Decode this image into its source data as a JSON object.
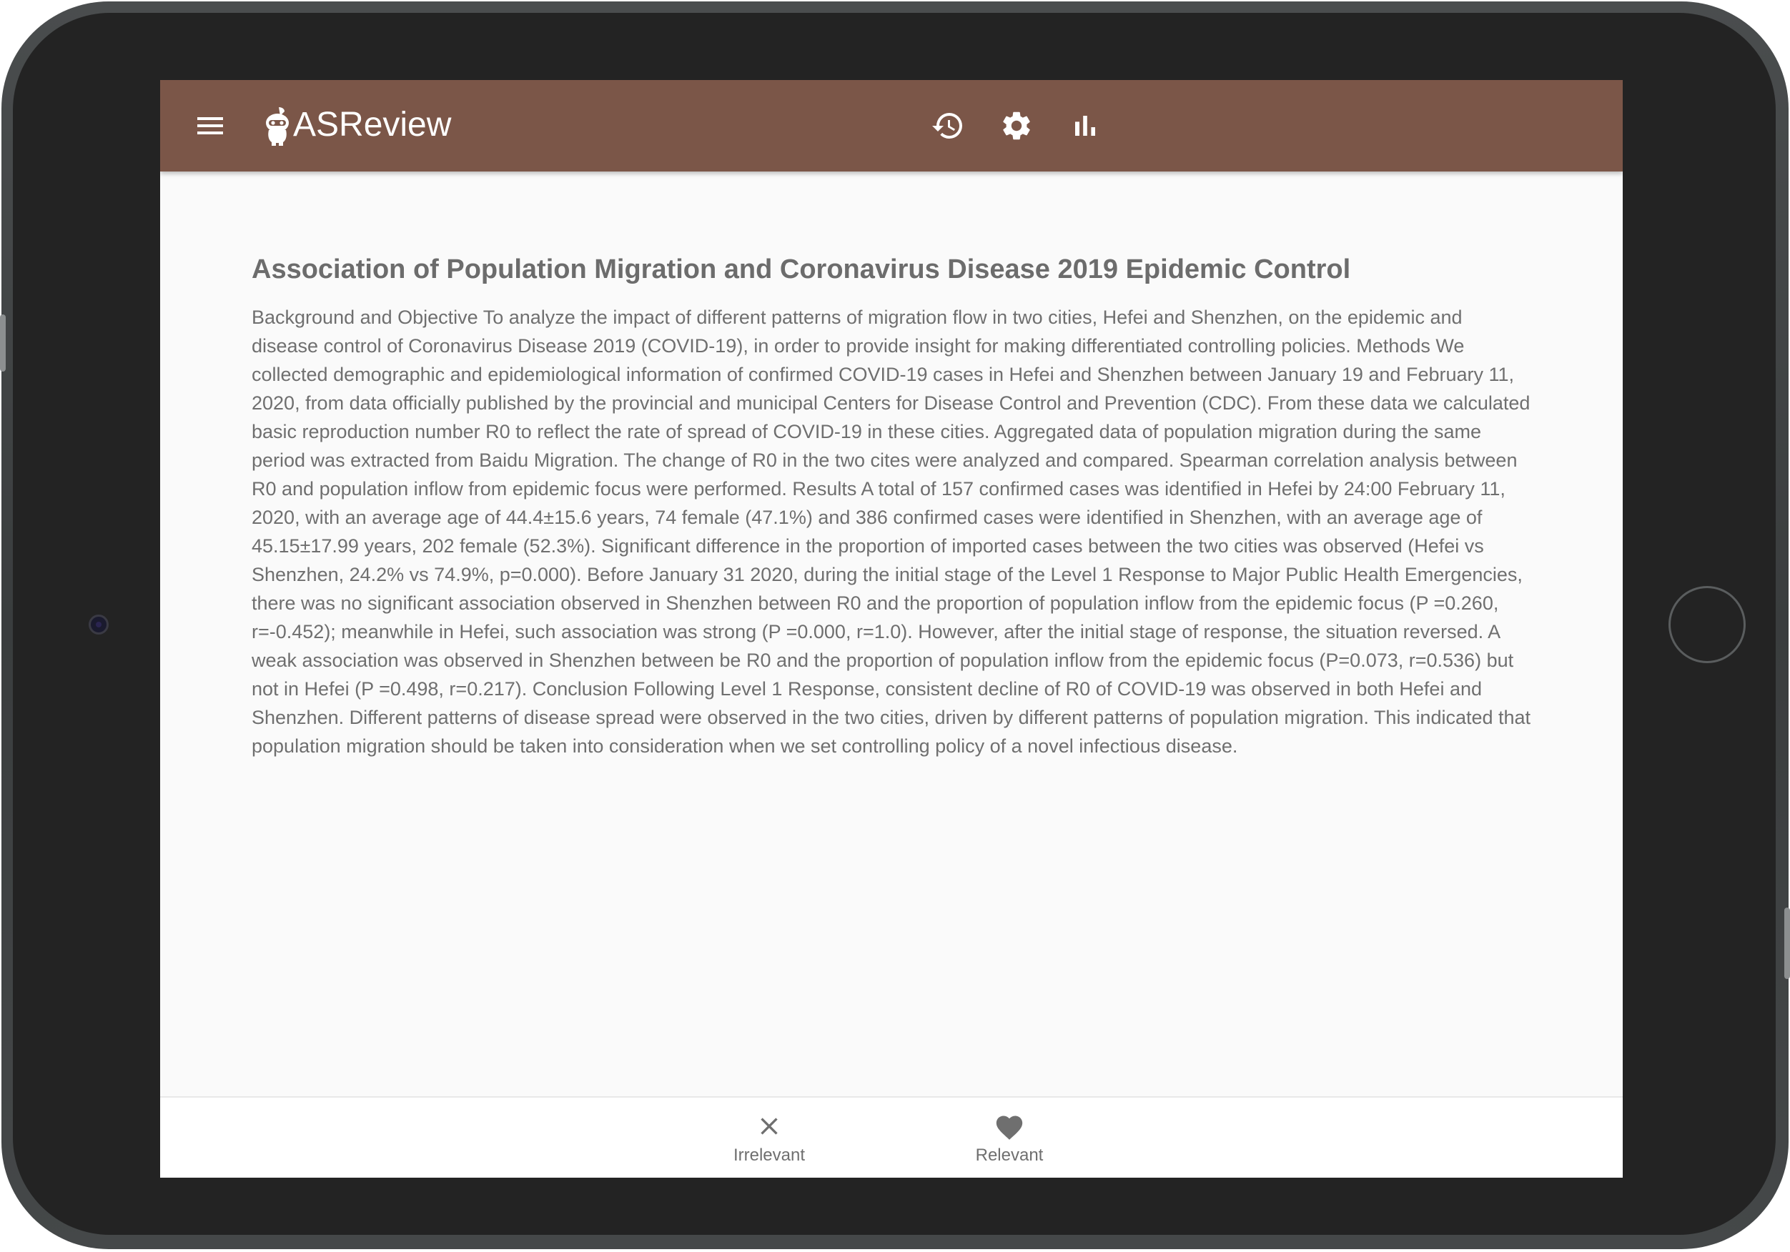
{
  "app": {
    "title": "ASReview"
  },
  "toolbar": {
    "icons": [
      "menu-icon",
      "asreview-logo-icon",
      "history-icon",
      "settings-gear-icon",
      "statistics-bar-chart-icon"
    ]
  },
  "colors": {
    "appbar": "#7b5648",
    "background": "#fafafa",
    "text": "#6f6f6f",
    "icons": "#ffffff",
    "action_icons": "#6f6f6f"
  },
  "record": {
    "title": "Association of Population Migration and Coronavirus Disease 2019 Epidemic Control",
    "abstract": "Background and Objective To analyze the impact of different patterns of migration flow in two cities, Hefei and Shenzhen, on the epidemic and disease control of Coronavirus Disease 2019 (COVID-19), in order to provide insight for making differentiated controlling policies. Methods We collected demographic and epidemiological information of confirmed COVID-19 cases in Hefei and Shenzhen between January 19 and February 11, 2020, from data officially published by the provincial and municipal Centers for Disease Control and Prevention (CDC). From these data we calculated basic reproduction number R0 to reflect the rate of spread of COVID-19 in these cities. Aggregated data of population migration during the same period was extracted from Baidu Migration. The change of R0 in the two cites were analyzed and compared. Spearman correlation analysis between R0 and population inflow from epidemic focus were performed. Results A total of 157 confirmed cases was identified in Hefei by 24:00 February 11, 2020, with an average age of 44.4±15.6 years, 74 female (47.1%) and 386 confirmed cases were identified in Shenzhen, with an average age of 45.15±17.99 years, 202 female (52.3%). Significant difference in the proportion of imported cases between the two cities was observed (Hefei vs Shenzhen, 24.2% vs 74.9%, p=0.000). Before January 31 2020, during the initial stage of the Level 1 Response to Major Public Health Emergencies, there was no significant association observed in Shenzhen between R0 and the proportion of population inflow from the epidemic focus (P =0.260, r=-0.452); meanwhile in Hefei, such association was strong (P =0.000, r=1.0). However, after the initial stage of response, the situation reversed. A weak association was observed in Shenzhen between be R0 and the proportion of population inflow from the epidemic focus (P=0.073, r=0.536) but not in Hefei (P =0.498, r=0.217). Conclusion Following Level 1 Response, consistent decline of R0 of COVID-19 was observed in both Hefei and Shenzhen. Different patterns of disease spread were observed in the two cities, driven by different patterns of population migration. This indicated that population migration should be taken into consideration when we set controlling policy of a novel infectious disease."
  },
  "actions": {
    "irrelevant": {
      "label": "Irrelevant",
      "icon": "close-x-icon"
    },
    "relevant": {
      "label": "Relevant",
      "icon": "heart-icon"
    }
  }
}
